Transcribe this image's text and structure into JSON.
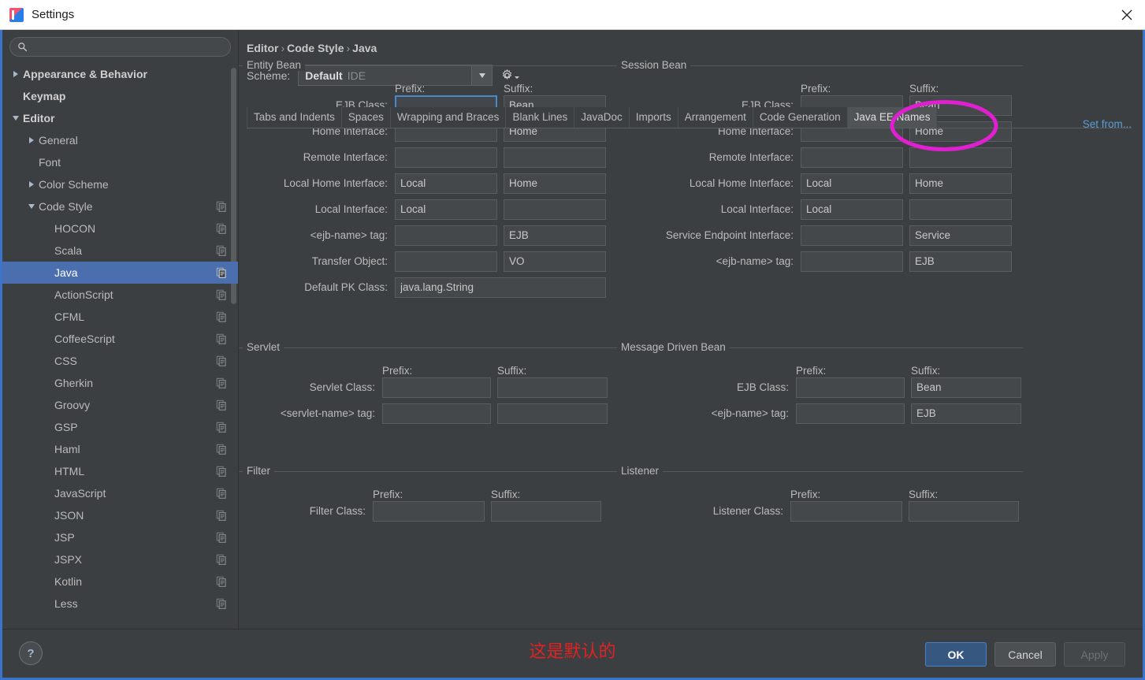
{
  "window": {
    "title": "Settings",
    "app_icon": "intellij-logo-icon",
    "close_icon": "close-icon"
  },
  "sidebar": {
    "search": {
      "placeholder": "",
      "value": "",
      "icon": "search-icon"
    },
    "items": [
      {
        "label": "Appearance & Behavior",
        "indent": 0,
        "twisty": "right",
        "bold": true,
        "copy": false,
        "selected": false
      },
      {
        "label": "Keymap",
        "indent": 0,
        "twisty": "none",
        "bold": true,
        "copy": false,
        "selected": false
      },
      {
        "label": "Editor",
        "indent": 0,
        "twisty": "down",
        "bold": true,
        "copy": false,
        "selected": false
      },
      {
        "label": "General",
        "indent": 1,
        "twisty": "right",
        "bold": false,
        "copy": false,
        "selected": false
      },
      {
        "label": "Font",
        "indent": 1,
        "twisty": "none",
        "bold": false,
        "copy": false,
        "selected": false
      },
      {
        "label": "Color Scheme",
        "indent": 1,
        "twisty": "right",
        "bold": false,
        "copy": false,
        "selected": false
      },
      {
        "label": "Code Style",
        "indent": 1,
        "twisty": "down",
        "bold": false,
        "copy": true,
        "selected": false
      },
      {
        "label": "HOCON",
        "indent": 2,
        "twisty": "none",
        "bold": false,
        "copy": true,
        "selected": false
      },
      {
        "label": "Scala",
        "indent": 2,
        "twisty": "none",
        "bold": false,
        "copy": true,
        "selected": false
      },
      {
        "label": "Java",
        "indent": 2,
        "twisty": "none",
        "bold": false,
        "copy": true,
        "selected": true
      },
      {
        "label": "ActionScript",
        "indent": 2,
        "twisty": "none",
        "bold": false,
        "copy": true,
        "selected": false
      },
      {
        "label": "CFML",
        "indent": 2,
        "twisty": "none",
        "bold": false,
        "copy": true,
        "selected": false
      },
      {
        "label": "CoffeeScript",
        "indent": 2,
        "twisty": "none",
        "bold": false,
        "copy": true,
        "selected": false
      },
      {
        "label": "CSS",
        "indent": 2,
        "twisty": "none",
        "bold": false,
        "copy": true,
        "selected": false
      },
      {
        "label": "Gherkin",
        "indent": 2,
        "twisty": "none",
        "bold": false,
        "copy": true,
        "selected": false
      },
      {
        "label": "Groovy",
        "indent": 2,
        "twisty": "none",
        "bold": false,
        "copy": true,
        "selected": false
      },
      {
        "label": "GSP",
        "indent": 2,
        "twisty": "none",
        "bold": false,
        "copy": true,
        "selected": false
      },
      {
        "label": "Haml",
        "indent": 2,
        "twisty": "none",
        "bold": false,
        "copy": true,
        "selected": false
      },
      {
        "label": "HTML",
        "indent": 2,
        "twisty": "none",
        "bold": false,
        "copy": true,
        "selected": false
      },
      {
        "label": "JavaScript",
        "indent": 2,
        "twisty": "none",
        "bold": false,
        "copy": true,
        "selected": false
      },
      {
        "label": "JSON",
        "indent": 2,
        "twisty": "none",
        "bold": false,
        "copy": true,
        "selected": false
      },
      {
        "label": "JSP",
        "indent": 2,
        "twisty": "none",
        "bold": false,
        "copy": true,
        "selected": false
      },
      {
        "label": "JSPX",
        "indent": 2,
        "twisty": "none",
        "bold": false,
        "copy": true,
        "selected": false
      },
      {
        "label": "Kotlin",
        "indent": 2,
        "twisty": "none",
        "bold": false,
        "copy": true,
        "selected": false
      },
      {
        "label": "Less",
        "indent": 2,
        "twisty": "none",
        "bold": false,
        "copy": true,
        "selected": false
      }
    ]
  },
  "content": {
    "breadcrumb": [
      "Editor",
      "Code Style",
      "Java"
    ],
    "scheme": {
      "label": "Scheme:",
      "value": "Default",
      "value_suffix": "IDE",
      "gear_icon": "gear-icon",
      "dropdown_icon": "chevron-down-icon"
    },
    "set_from_link": "Set from...",
    "tabs": [
      {
        "label": "Tabs and Indents",
        "active": false
      },
      {
        "label": "Spaces",
        "active": false
      },
      {
        "label": "Wrapping and Braces",
        "active": false
      },
      {
        "label": "Blank Lines",
        "active": false
      },
      {
        "label": "JavaDoc",
        "active": false
      },
      {
        "label": "Imports",
        "active": false
      },
      {
        "label": "Arrangement",
        "active": false
      },
      {
        "label": "Code Generation",
        "active": false
      },
      {
        "label": "Java EE Names",
        "active": true
      }
    ],
    "column_headers": {
      "prefix": "Prefix:",
      "suffix": "Suffix:"
    },
    "groups": {
      "entity_bean": {
        "title": "Entity Bean",
        "rows": [
          {
            "label": "EJB Class:",
            "prefix": "",
            "suffix": "Bean",
            "focused": true
          },
          {
            "label": "Home Interface:",
            "prefix": "",
            "suffix": "Home",
            "focused": false
          },
          {
            "label": "Remote Interface:",
            "prefix": "",
            "suffix": "",
            "focused": false
          },
          {
            "label": "Local Home Interface:",
            "prefix": "Local",
            "suffix": "Home",
            "focused": false
          },
          {
            "label": "Local Interface:",
            "prefix": "Local",
            "suffix": "",
            "focused": false
          },
          {
            "label": "<ejb-name> tag:",
            "prefix": "",
            "suffix": "EJB",
            "focused": false
          },
          {
            "label": "Transfer Object:",
            "prefix": "",
            "suffix": "VO",
            "focused": false
          }
        ],
        "wide_row": {
          "label": "Default PK Class:",
          "value": "java.lang.String"
        }
      },
      "session_bean": {
        "title": "Session Bean",
        "rows": [
          {
            "label": "EJB Class:",
            "prefix": "",
            "suffix": "Bean",
            "focused": false
          },
          {
            "label": "Home Interface:",
            "prefix": "",
            "suffix": "Home",
            "focused": false
          },
          {
            "label": "Remote Interface:",
            "prefix": "",
            "suffix": "",
            "focused": false
          },
          {
            "label": "Local Home Interface:",
            "prefix": "Local",
            "suffix": "Home",
            "focused": false
          },
          {
            "label": "Local Interface:",
            "prefix": "Local",
            "suffix": "",
            "focused": false
          },
          {
            "label": "Service Endpoint Interface:",
            "prefix": "",
            "suffix": "Service",
            "focused": false
          },
          {
            "label": "<ejb-name> tag:",
            "prefix": "",
            "suffix": "EJB",
            "focused": false
          }
        ]
      },
      "servlet": {
        "title": "Servlet",
        "rows": [
          {
            "label": "Servlet Class:",
            "prefix": "",
            "suffix": "",
            "focused": false
          },
          {
            "label": "<servlet-name> tag:",
            "prefix": "",
            "suffix": "",
            "focused": false
          }
        ]
      },
      "message_driven_bean": {
        "title": "Message Driven Bean",
        "rows": [
          {
            "label": "EJB Class:",
            "prefix": "",
            "suffix": "Bean",
            "focused": false
          },
          {
            "label": "<ejb-name> tag:",
            "prefix": "",
            "suffix": "EJB",
            "focused": false
          }
        ]
      },
      "filter": {
        "title": "Filter",
        "rows": [
          {
            "label": "Filter Class:",
            "prefix": "",
            "suffix": "",
            "focused": false
          }
        ]
      },
      "listener": {
        "title": "Listener",
        "rows": [
          {
            "label": "Listener Class:",
            "prefix": "",
            "suffix": "",
            "focused": false
          }
        ]
      }
    }
  },
  "footer": {
    "help_label": "?",
    "annotation_text": "这是默认的",
    "annotation_color": "#e02222",
    "buttons": [
      {
        "label": "OK",
        "state": "default"
      },
      {
        "label": "Cancel",
        "state": "normal"
      },
      {
        "label": "Apply",
        "state": "disabled"
      }
    ]
  },
  "annotations": {
    "highlight_ellipse": {
      "target": "Java EE Names",
      "color": "#e020d0"
    }
  }
}
